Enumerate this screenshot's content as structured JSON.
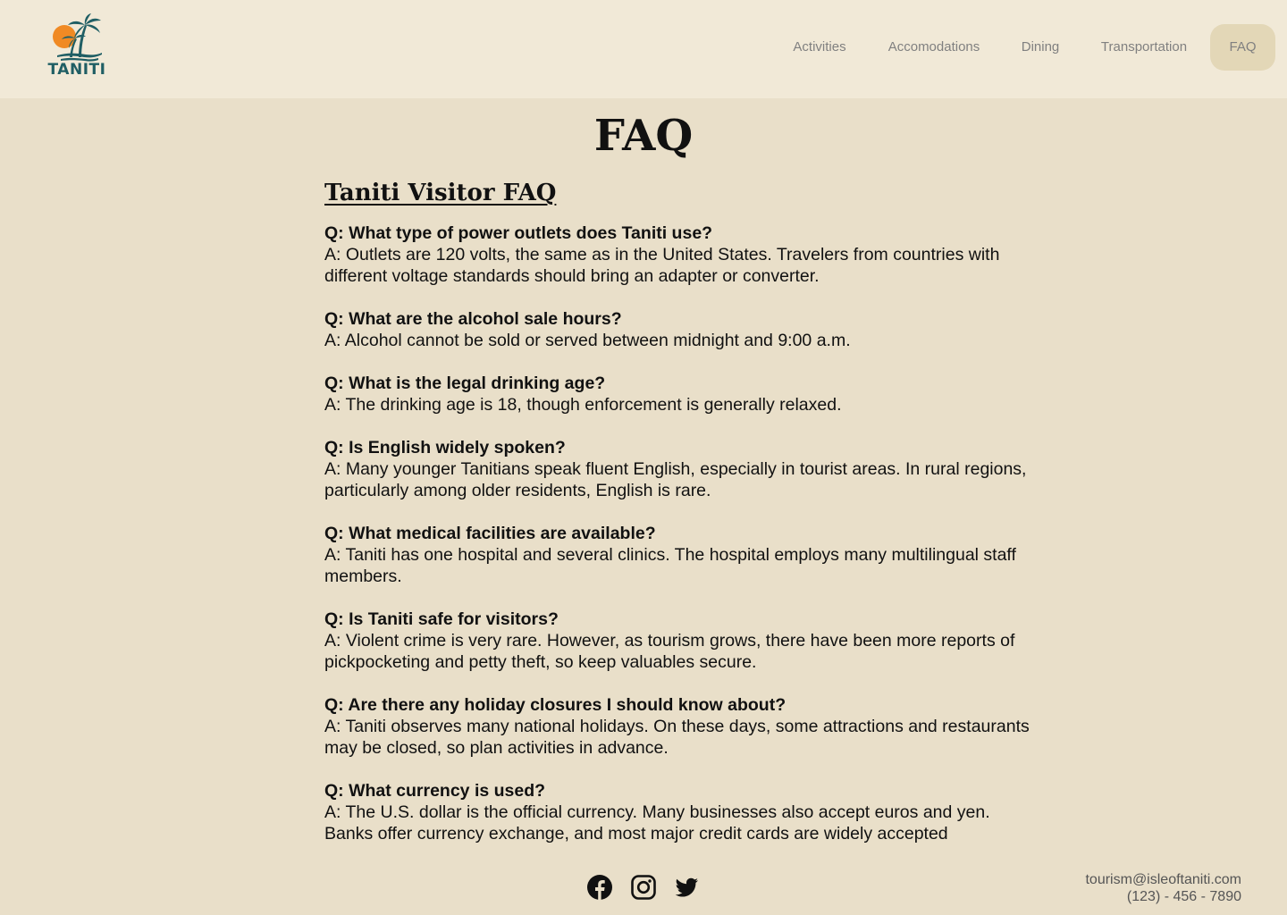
{
  "header": {
    "logo_text": "TANITI",
    "nav": [
      {
        "label": "Activities",
        "active": false
      },
      {
        "label": "Accomodations",
        "active": false
      },
      {
        "label": "Dining",
        "active": false
      },
      {
        "label": "Transportation",
        "active": false
      },
      {
        "label": "FAQ",
        "active": true
      }
    ]
  },
  "page": {
    "title": "FAQ",
    "subtitle": "Taniti Visitor FAQ"
  },
  "faq": [
    {
      "q": "Q: What type of power outlets does Taniti use?",
      "a": "A: Outlets are 120 volts, the same as in the United States. Travelers from countries with different voltage standards should bring an adapter or converter."
    },
    {
      "q": "Q: What are the alcohol sale hours?",
      "a": "A: Alcohol cannot be sold or served between midnight and 9:00 a.m."
    },
    {
      "q": "Q: What is the legal drinking age?",
      "a": "A: The drinking age is 18, though enforcement is generally relaxed."
    },
    {
      "q": "Q: Is English widely spoken?",
      "a": "A: Many younger Tanitians speak fluent English, especially in tourist areas. In rural regions, particularly among older residents, English is rare."
    },
    {
      "q": "Q: What medical facilities are available?",
      "a": "A: Taniti has one hospital and several clinics. The hospital employs many multilingual staff members."
    },
    {
      "q": "Q: Is Taniti safe for visitors?",
      "a": "A: Violent crime is very rare. However, as tourism grows, there have been more reports of pickpocketing and petty theft, so keep valuables secure."
    },
    {
      "q": "Q: Are there any holiday closures I should know about?",
      "a": "A: Taniti observes many national holidays. On these days, some attractions and restaurants may be closed, so plan activities in advance."
    },
    {
      "q": "Q: What currency is used?",
      "a": "A: The U.S. dollar is the official currency. Many businesses also accept euros and yen. Banks offer currency exchange, and most major credit cards are widely accepted"
    }
  ],
  "footer": {
    "social_icons": [
      "facebook-icon",
      "instagram-icon",
      "twitter-icon"
    ],
    "email": "tourism@isleoftaniti.com",
    "phone": "(123) - 456 - 7890"
  },
  "colors": {
    "background": "#e9dfc9",
    "header_bg": "#f1e9d7",
    "nav_active_bg": "#e3d7b7",
    "logo_teal": "#1f5e64",
    "logo_sun": "#f08a24"
  }
}
